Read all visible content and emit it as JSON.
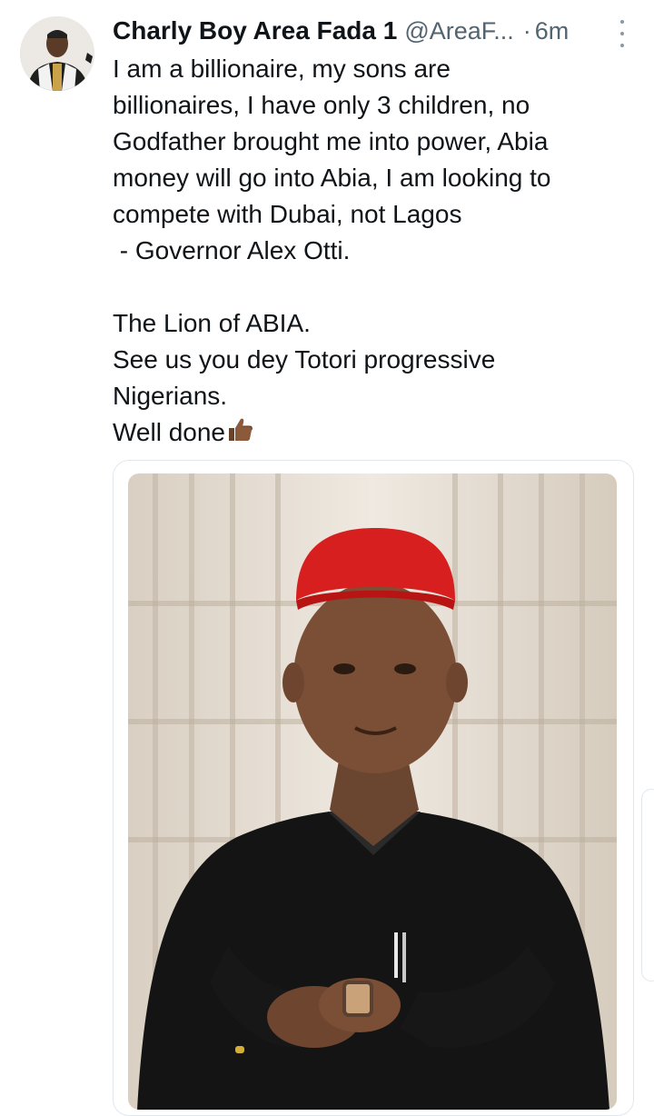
{
  "tweet": {
    "display_name": "Charly Boy Area Fada 1",
    "handle": "@AreaF...",
    "separator": "·",
    "time": "6m",
    "lines": [
      "I am a billionaire, my sons are",
      "billionaires, I have only 3 children, no",
      "Godfather brought me into power, Abia",
      "money will go into Abia, I am looking to",
      "compete with Dubai, not Lagos",
      " - Governor Alex Otti."
    ],
    "lines2": [
      "The Lion of ABIA.",
      "See us you dey Totori progressive",
      "Nigerians.",
      "Well done"
    ],
    "emoji": "thumbs-up-icon"
  },
  "colors": {
    "text": "#0f1419",
    "secondary": "#536471",
    "border": "#e1e8ed"
  }
}
